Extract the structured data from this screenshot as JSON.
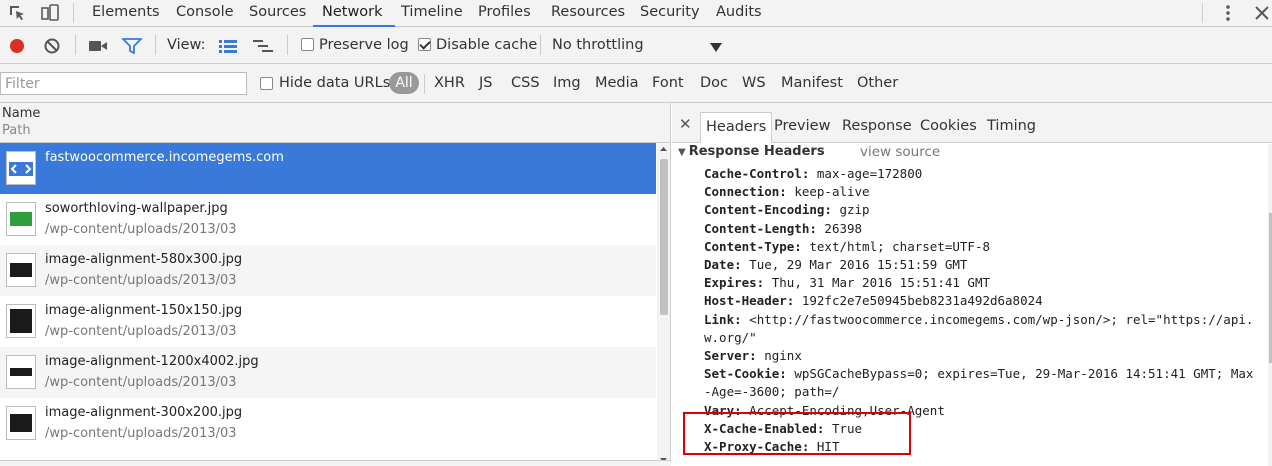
{
  "devtools": {
    "main_tabs": [
      "Elements",
      "Console",
      "Sources",
      "Network",
      "Timeline",
      "Profiles",
      "Resources",
      "Security",
      "Audits"
    ],
    "active_tab": "Network",
    "accent_color": "#3879d9"
  },
  "toolbar": {
    "view_label": "View:",
    "preserve_log": {
      "label": "Preserve log",
      "checked": false
    },
    "disable_cache": {
      "label": "Disable cache",
      "checked": true
    },
    "throttling": "No throttling",
    "record_color": "#d93025"
  },
  "filterbar": {
    "placeholder": "Filter",
    "hide_data_urls": {
      "label": "Hide data URLs",
      "checked": false
    },
    "types": [
      "All",
      "XHR",
      "JS",
      "CSS",
      "Img",
      "Media",
      "Font",
      "Doc",
      "WS",
      "Manifest",
      "Other"
    ],
    "active_type": "All"
  },
  "request_list": {
    "columns": {
      "name": "Name",
      "path": "Path"
    },
    "rows": [
      {
        "name": "fastwoocommerce.incomegems.com",
        "path": "",
        "icon": "document-icon",
        "selected": true
      },
      {
        "name": "soworthloving-wallpaper.jpg",
        "path": "/wp-content/uploads/2013/03",
        "icon": "image-thumb-green",
        "selected": false
      },
      {
        "name": "image-alignment-580x300.jpg",
        "path": "/wp-content/uploads/2013/03",
        "icon": "image-thumb-dark",
        "selected": false
      },
      {
        "name": "image-alignment-150x150.jpg",
        "path": "/wp-content/uploads/2013/03",
        "icon": "image-thumb-dark",
        "selected": false
      },
      {
        "name": "image-alignment-1200x4002.jpg",
        "path": "/wp-content/uploads/2013/03",
        "icon": "image-thumb-dark",
        "selected": false
      },
      {
        "name": "image-alignment-300x200.jpg",
        "path": "/wp-content/uploads/2013/03",
        "icon": "image-thumb-dark",
        "selected": false
      }
    ]
  },
  "details": {
    "tabs": [
      "Headers",
      "Preview",
      "Response",
      "Cookies",
      "Timing"
    ],
    "active_tab": "Headers",
    "section_title": "Response Headers",
    "view_source": "view source",
    "headers": [
      {
        "key": "Cache-Control:",
        "value": "max-age=172800"
      },
      {
        "key": "Connection:",
        "value": "keep-alive"
      },
      {
        "key": "Content-Encoding:",
        "value": "gzip"
      },
      {
        "key": "Content-Length:",
        "value": "26398"
      },
      {
        "key": "Content-Type:",
        "value": "text/html; charset=UTF-8"
      },
      {
        "key": "Date:",
        "value": "Tue, 29 Mar 2016 15:51:59 GMT"
      },
      {
        "key": "Expires:",
        "value": "Thu, 31 Mar 2016 15:51:41 GMT"
      },
      {
        "key": "Host-Header:",
        "value": "192fc2e7e50945beb8231a492d6a8024"
      },
      {
        "key": "Link:",
        "value": "<http://fastwoocommerce.incomegems.com/wp-json/>; rel=\"https://api.w.org/\""
      },
      {
        "key": "Server:",
        "value": "nginx"
      },
      {
        "key": "Set-Cookie:",
        "value": "wpSGCacheBypass=0; expires=Tue, 29-Mar-2016 14:51:41 GMT; Max-Age=-3600; path=/"
      },
      {
        "key": "Vary:",
        "value": "Accept-Encoding,User-Agent"
      },
      {
        "key": "X-Cache-Enabled:",
        "value": "True"
      },
      {
        "key": "X-Proxy-Cache:",
        "value": "HIT"
      }
    ],
    "highlight_color": "#dd0000"
  }
}
